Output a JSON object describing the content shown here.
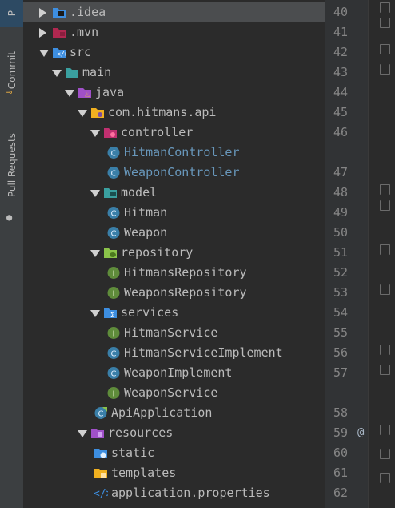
{
  "sidebar": {
    "tabs": [
      {
        "label": "P"
      },
      {
        "label": "Commit"
      },
      {
        "label": "Pull Requests"
      }
    ]
  },
  "tree": {
    "items": [
      {
        "label": ".idea",
        "icon": "folder-idea-icon",
        "color": "#bbbbbb",
        "expanded": false
      },
      {
        "label": ".mvn",
        "icon": "folder-mvn-icon",
        "color": "#bbbbbb",
        "expanded": false
      },
      {
        "label": "src",
        "icon": "folder-src-icon",
        "color": "#bbbbbb",
        "expanded": true
      },
      {
        "label": "main",
        "icon": "folder-main-icon",
        "color": "#bbbbbb",
        "expanded": true
      },
      {
        "label": "java",
        "icon": "folder-java-icon",
        "color": "#bbbbbb",
        "expanded": true
      },
      {
        "label": "com.hitmans.api",
        "icon": "package-icon",
        "color": "#bbbbbb",
        "expanded": true
      },
      {
        "label": "controller",
        "icon": "folder-controller-icon",
        "color": "#bbbbbb",
        "expanded": true
      },
      {
        "label": "HitmanController",
        "icon": "class-icon",
        "color": "#6897bb"
      },
      {
        "label": "WeaponController",
        "icon": "class-icon",
        "color": "#6897bb"
      },
      {
        "label": "model",
        "icon": "folder-model-icon",
        "color": "#bbbbbb",
        "expanded": true
      },
      {
        "label": "Hitman",
        "icon": "class-icon",
        "color": "#bbbbbb"
      },
      {
        "label": "Weapon",
        "icon": "class-icon",
        "color": "#bbbbbb"
      },
      {
        "label": "repository",
        "icon": "folder-repository-icon",
        "color": "#bbbbbb",
        "expanded": true
      },
      {
        "label": "HitmansRepository",
        "icon": "interface-icon",
        "color": "#bbbbbb"
      },
      {
        "label": "WeaponsRepository",
        "icon": "interface-icon",
        "color": "#bbbbbb"
      },
      {
        "label": "services",
        "icon": "folder-services-icon",
        "color": "#bbbbbb",
        "expanded": true
      },
      {
        "label": "HitmanService",
        "icon": "interface-icon",
        "color": "#bbbbbb"
      },
      {
        "label": "HitmanServiceImplement",
        "icon": "class-icon",
        "color": "#bbbbbb"
      },
      {
        "label": "WeaponImplement",
        "icon": "class-icon",
        "color": "#bbbbbb"
      },
      {
        "label": "WeaponService",
        "icon": "interface-icon",
        "color": "#bbbbbb"
      },
      {
        "label": "ApiApplication",
        "icon": "spring-boot-class-icon",
        "color": "#bbbbbb"
      },
      {
        "label": "resources",
        "icon": "folder-resources-icon",
        "color": "#bbbbbb",
        "expanded": true
      },
      {
        "label": "static",
        "icon": "folder-static-icon",
        "color": "#bbbbbb"
      },
      {
        "label": "templates",
        "icon": "folder-templates-icon",
        "color": "#bbbbbb"
      },
      {
        "label": "application.properties",
        "icon": "properties-file-icon",
        "color": "#bbbbbb"
      }
    ]
  },
  "gutter": {
    "line_numbers": [
      "40",
      "41",
      "42",
      "43",
      "44",
      "45",
      "46",
      "47",
      "48",
      "49",
      "50",
      "51",
      "52",
      "53",
      "54",
      "55",
      "56",
      "57",
      "58",
      "59",
      "60",
      "61",
      "62"
    ],
    "annotation": "@"
  },
  "colors": {
    "background": "#2b2b2b",
    "selection": "#4b4d4f",
    "class_blue": "#6897bb",
    "interface_green": "#5f8c3b",
    "folder_blue": "#3d8ee0",
    "folder_purple": "#a050c8",
    "folder_teal": "#3aa0a0",
    "folder_yellow": "#f0b020"
  }
}
